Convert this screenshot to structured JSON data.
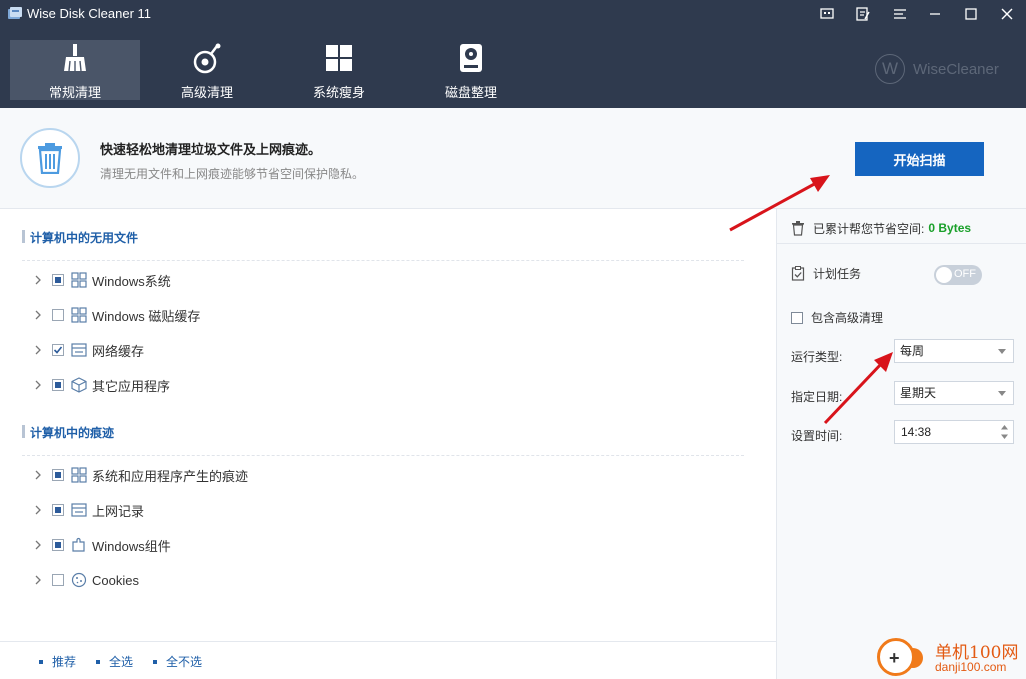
{
  "window": {
    "title": "Wise Disk Cleaner 11"
  },
  "nav": {
    "tabs": [
      {
        "label": "常规清理",
        "icon": "broom-icon",
        "active": true
      },
      {
        "label": "高级清理",
        "icon": "scan-disk-icon",
        "active": false
      },
      {
        "label": "系统瘦身",
        "icon": "windows-logo-icon",
        "active": false
      },
      {
        "label": "磁盘整理",
        "icon": "hard-drive-icon",
        "active": false
      }
    ],
    "brand": {
      "mark": "W",
      "text": "WiseCleaner"
    }
  },
  "intro": {
    "title": "快速轻松地清理垃圾文件及上网痕迹。",
    "subtitle": "清理无用文件和上网痕迹能够节省空间保护隐私。",
    "scan_button": "开始扫描"
  },
  "sections": [
    {
      "title": "计算机中的无用文件",
      "items": [
        {
          "label": "Windows系统",
          "state": "partial",
          "icon": "windows-tiles-icon"
        },
        {
          "label": "Windows 磁贴缓存",
          "state": "unchecked",
          "icon": "windows-tiles-icon"
        },
        {
          "label": "网络缓存",
          "state": "checked",
          "icon": "browser-cache-icon"
        },
        {
          "label": "其它应用程序",
          "state": "partial",
          "icon": "package-box-icon"
        }
      ]
    },
    {
      "title": "计算机中的痕迹",
      "items": [
        {
          "label": "系统和应用程序产生的痕迹",
          "state": "partial",
          "icon": "windows-tiles-icon"
        },
        {
          "label": "上网记录",
          "state": "partial",
          "icon": "browser-history-icon"
        },
        {
          "label": "Windows组件",
          "state": "partial",
          "icon": "puzzle-component-icon"
        },
        {
          "label": "Cookies",
          "state": "unchecked",
          "icon": "cookie-icon"
        }
      ]
    }
  ],
  "footer": {
    "links": [
      "推荐",
      "全选",
      "全不选"
    ]
  },
  "right_panel": {
    "saved_label": "已累计帮您节省空间:",
    "saved_value": "0 Bytes",
    "schedule_label": "计划任务",
    "toggle_label": "OFF",
    "toggle_on": false,
    "include_advanced": "包含高级清理",
    "run_type_label": "运行类型:",
    "run_type_value": "每周",
    "date_label": "指定日期:",
    "date_value": "星期天",
    "time_label": "设置时间:",
    "time_value": "14:38"
  },
  "watermark": {
    "name": "单机100网",
    "url": "danji100.com"
  },
  "colors": {
    "header_bg": "#2f3a4e",
    "accent_blue": "#1565c0",
    "saved_green": "#1aa02a",
    "arrow_red": "#d8141b"
  }
}
